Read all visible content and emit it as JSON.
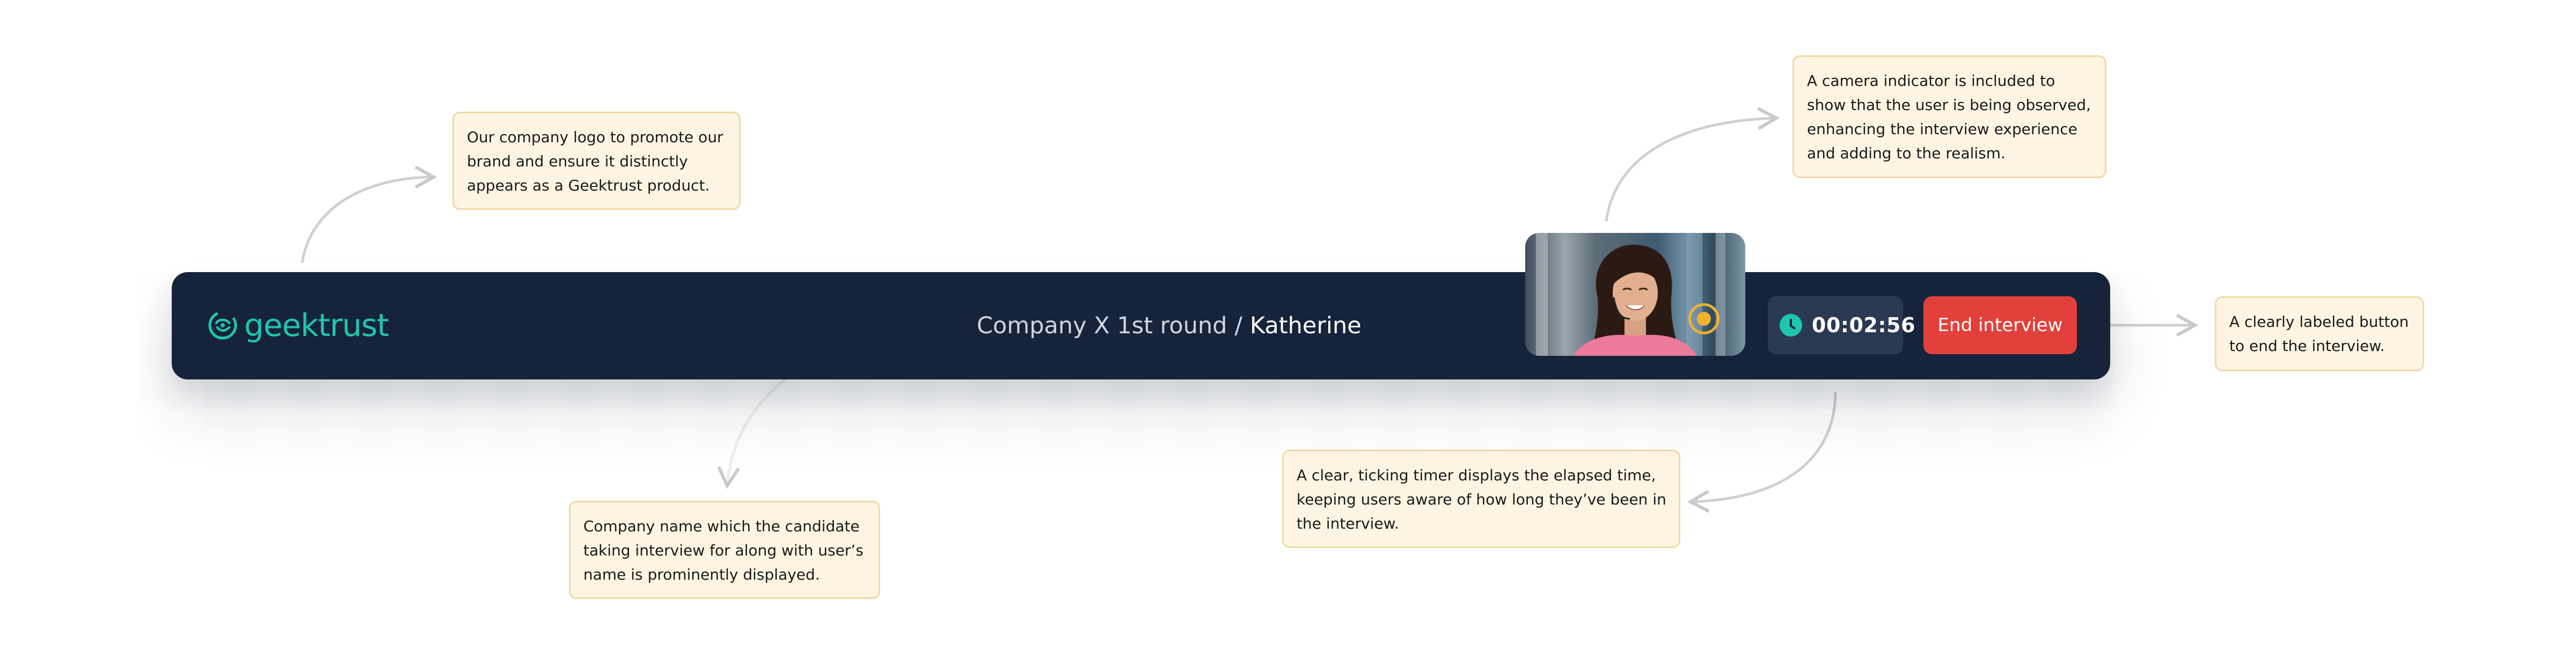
{
  "brand": {
    "name": "geektrust",
    "primary_color": "#1fc5b0",
    "bar_color": "#16243b"
  },
  "interview": {
    "round": "Company X 1st round",
    "separator": "/",
    "candidate": "Katherine"
  },
  "camera": {
    "indicator_icon": "record-dot-icon",
    "indicator_color": "#f0b32e"
  },
  "timer": {
    "icon": "clock-icon",
    "value": "00:02:56"
  },
  "end_button": {
    "label": "End interview",
    "color": "#e2403a"
  },
  "annotations": {
    "logo": [
      "Our company logo to promote our",
      "brand and ensure it distinctly",
      "appears as a Geektrust product."
    ],
    "camera": [
      "A camera indicator is included to",
      "show that the user is being observed,",
      "enhancing the interview experience",
      "and adding to the realism."
    ],
    "end_button": [
      "A clearly labeled button",
      "to end the interview."
    ],
    "title": [
      "Company name which the candidate",
      "taking interview for along with user’s",
      "name is prominently displayed."
    ],
    "timer": [
      "A clear, ticking timer displays the elapsed time,",
      "keeping users aware of how long they’ve been in",
      "the interview."
    ]
  }
}
